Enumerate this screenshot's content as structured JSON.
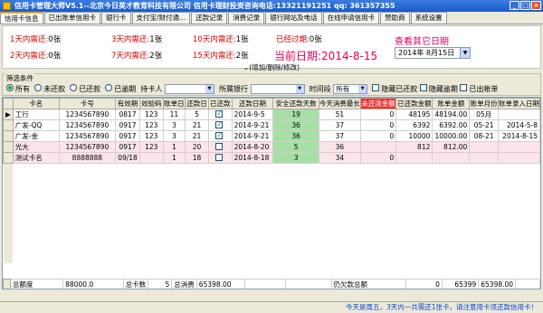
{
  "window": {
    "title": "信用卡管理大师V5.1--北京今日英才教育科技有限公司 信用卡理财投资咨询电话:13321191251  qq: 361357355"
  },
  "tabs": [
    "信用卡信息",
    "已出账单信用卡",
    "银行卡",
    "支付宝/财付通...",
    "还款记录",
    "消费记录",
    "银行网站及电话",
    "在线申请信用卡",
    "赞助商",
    "系统设置"
  ],
  "alerts": {
    "due1": {
      "label": "1天内需还:",
      "value": "0张"
    },
    "due3": {
      "label": "3天内需还:",
      "value": "1张"
    },
    "due10": {
      "label": "10天内需还:",
      "value": "1张"
    },
    "overdue": {
      "label": "已经过期:",
      "value": "0张"
    },
    "due2": {
      "label": "2天内需还:",
      "value": "0张"
    },
    "due7": {
      "label": "7天内需还:",
      "value": "2张"
    },
    "due15": {
      "label": "15天内需还:",
      "value": "2张"
    },
    "current_date": "当前日期:2014-8-15",
    "query_other": "查看其它日期",
    "date_value": "2014年  8月15日"
  },
  "expander": "(增加/删除/修改)",
  "filter": {
    "title": "筛选条件",
    "radios": [
      "所有",
      "未还款",
      "已还款",
      "已逾期"
    ],
    "holder_label": "持卡人",
    "bank_label": "所属银行",
    "period_label": "时间段",
    "period_value": "所有",
    "checks": [
      "隐藏已还款",
      "隐藏逾期",
      "已出帐单"
    ]
  },
  "columns": [
    "卡名",
    "卡号",
    "有效期",
    "效验码",
    "账单日",
    "还款日",
    "已还款",
    "还款日期",
    "安全还款天数",
    "今天消费最长",
    "未还清金额",
    "已还款金额",
    "账单金额",
    "账单月份",
    "账单录入日期"
  ],
  "rows": [
    {
      "marker": "▶",
      "name": "工行",
      "no": "1234567890",
      "exp": "0817",
      "cvv": "123",
      "bill": "11",
      "pay": "5",
      "paid": true,
      "paydate": "2014-9-5",
      "safe": "19",
      "longest": "51",
      "unpaid": "0",
      "paidamt": "48195",
      "billamt": "48194.00",
      "month": "05月",
      "entry": "",
      "pink": false
    },
    {
      "marker": "",
      "name": "广发-QQ",
      "no": "1234567890",
      "exp": "0917",
      "cvv": "123",
      "bill": "3",
      "pay": "21",
      "paid": true,
      "paydate": "2014-9-21",
      "safe": "36",
      "longest": "37",
      "unpaid": "0",
      "paidamt": "6392",
      "billamt": "6392.00",
      "month": "05-21",
      "entry": "2014-5-8",
      "pink": false
    },
    {
      "marker": "",
      "name": "广发-金",
      "no": "1234567890",
      "exp": "0917",
      "cvv": "123",
      "bill": "3",
      "pay": "21",
      "paid": true,
      "paydate": "2014-9-21",
      "safe": "36",
      "longest": "37",
      "unpaid": "0",
      "paidamt": "10000",
      "billamt": "10000.00",
      "month": "08-21",
      "entry": "2014-8-15",
      "pink": false
    },
    {
      "marker": "",
      "name": "光大",
      "no": "1234567890",
      "exp": "0917",
      "cvv": "123",
      "bill": "1",
      "pay": "20",
      "paid": false,
      "paydate": "2014-8-20",
      "safe": "5",
      "longest": "36",
      "unpaid": "",
      "paidamt": "812",
      "billamt": "812.00",
      "month": "",
      "entry": "",
      "pink": true
    },
    {
      "marker": "",
      "name": "测试卡名",
      "no": "8888888",
      "exp": "09/18",
      "cvv": "",
      "bill": "1",
      "pay": "18",
      "paid": false,
      "paydate": "2014-8-18",
      "safe": "3",
      "longest": "34",
      "unpaid": "0",
      "paidamt": "",
      "billamt": "",
      "month": "",
      "entry": "",
      "pink": true
    }
  ],
  "footer": {
    "limit_label": "总额度",
    "limit_value": "88000.0",
    "cards_label": "总卡数",
    "cards_value": "5",
    "consume_label": "总消费",
    "consume_value": "65398.00",
    "owe_label": "仍欠款总额",
    "owe_value": "0",
    "paid_total": "65399",
    "bill_total": "65398.00"
  },
  "status": "今天是周五，3天内一共需还1张卡，请注意用卡须还款信用卡！"
}
